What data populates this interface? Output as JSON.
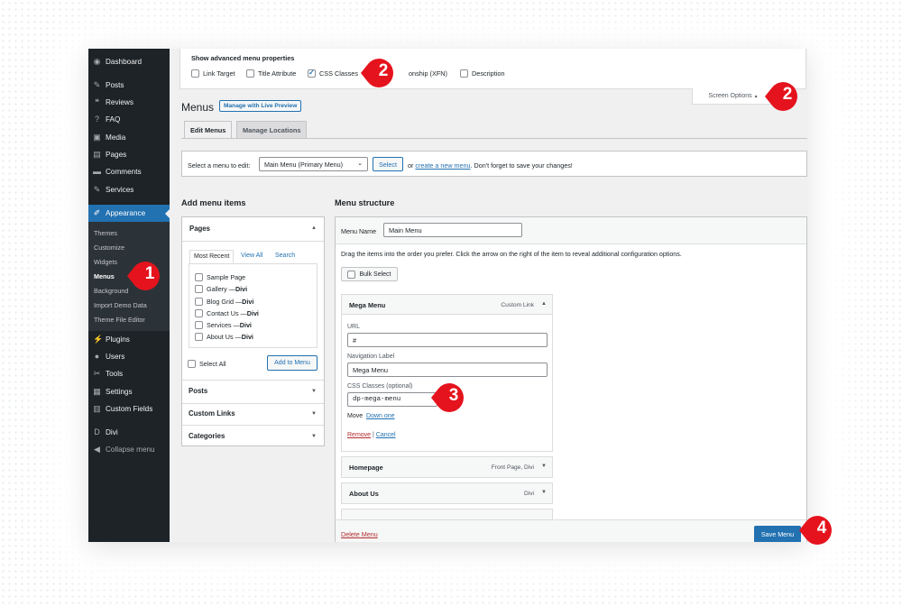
{
  "sidebar": {
    "items": [
      {
        "label": "Dashboard",
        "icon": "gauge-icon",
        "glyph": "◉"
      },
      {
        "label": "Posts",
        "icon": "pushpin-icon",
        "glyph": "✎"
      },
      {
        "label": "Reviews",
        "icon": "quote-icon",
        "glyph": "❝"
      },
      {
        "label": "FAQ",
        "icon": "question-icon",
        "glyph": "?"
      },
      {
        "label": "Media",
        "icon": "media-icon",
        "glyph": "▣"
      },
      {
        "label": "Pages",
        "icon": "pages-icon",
        "glyph": "▤"
      },
      {
        "label": "Comments",
        "icon": "comment-icon",
        "glyph": "▬"
      },
      {
        "label": "Services",
        "icon": "pushpin-icon",
        "glyph": "✎"
      },
      {
        "label": "Appearance",
        "icon": "brush-icon",
        "glyph": "✐"
      },
      {
        "label": "Plugins",
        "icon": "plugin-icon",
        "glyph": "⚡"
      },
      {
        "label": "Users",
        "icon": "user-icon",
        "glyph": "●"
      },
      {
        "label": "Tools",
        "icon": "wrench-icon",
        "glyph": "✂"
      },
      {
        "label": "Settings",
        "icon": "settings-icon",
        "glyph": "▦"
      },
      {
        "label": "Custom Fields",
        "icon": "fields-icon",
        "glyph": "▥"
      },
      {
        "label": "Divi",
        "icon": "divi-icon",
        "glyph": "D"
      },
      {
        "label": "Collapse menu",
        "icon": "collapse-icon",
        "glyph": "◀"
      }
    ],
    "submenu": [
      "Themes",
      "Customize",
      "Widgets",
      "Menus",
      "Background",
      "Import Demo Data",
      "Theme File Editor"
    ],
    "current": "Menus"
  },
  "screen_options": {
    "title": "Show advanced menu properties",
    "checkboxes": [
      {
        "label": "Link Target",
        "checked": false
      },
      {
        "label": "Title Attribute",
        "checked": false
      },
      {
        "label": "CSS Classes",
        "checked": true
      },
      {
        "label": "onship (XFN)",
        "checked": false
      },
      {
        "label": "Description",
        "checked": false
      }
    ],
    "toggle_label": "Screen Options",
    "toggle_arrow": "▲"
  },
  "header": {
    "title": "Menus",
    "live_preview": "Manage with Live Preview",
    "tabs": [
      "Edit Menus",
      "Manage Locations"
    ]
  },
  "select_bar": {
    "label": "Select a menu to edit:",
    "selected": "Main Menu (Primary Menu)",
    "button": "Select",
    "text_before": "or",
    "link": "create a new menu",
    "text_after": ". Don't forget to save your changes!"
  },
  "add_items": {
    "heading": "Add menu items",
    "pages_title": "Pages",
    "tabs": [
      "Most Recent",
      "View All",
      "Search"
    ],
    "pages": [
      {
        "name": "Sample Page",
        "suffix": ""
      },
      {
        "name": "Gallery — ",
        "suffix": "Divi"
      },
      {
        "name": "Blog Grid — ",
        "suffix": "Divi"
      },
      {
        "name": "Contact Us — ",
        "suffix": "Divi"
      },
      {
        "name": "Services — ",
        "suffix": "Divi"
      },
      {
        "name": "About Us — ",
        "suffix": "Divi"
      }
    ],
    "select_all": "Select All",
    "add_button": "Add to Menu",
    "sections": [
      "Posts",
      "Custom Links",
      "Categories"
    ]
  },
  "structure": {
    "heading": "Menu structure",
    "name_label": "Menu Name",
    "name_value": "Main Menu",
    "description": "Drag the items into the order you prefer. Click the arrow on the right of the item to reveal additional configuration options.",
    "bulk_select": "Bulk Select",
    "open_item": {
      "title": "Mega Menu",
      "type": "Custom Link",
      "url_label": "URL",
      "url_value": "#",
      "nav_label": "Navigation Label",
      "nav_value": "Mega Menu",
      "css_label": "CSS Classes (optional)",
      "css_value": "dp-mega-menu",
      "move_label": "Move",
      "move_link": "Down one",
      "remove": "Remove",
      "separator": "|",
      "cancel": "Cancel"
    },
    "items": [
      {
        "title": "Homepage",
        "type": "Front Page, Divi"
      },
      {
        "title": "About Us",
        "type": "Divi"
      }
    ],
    "delete_link": "Delete Menu",
    "save_button": "Save Menu"
  },
  "callouts": [
    "2",
    "2",
    "1",
    "3",
    "4"
  ],
  "colors": {
    "accent": "#2271b1",
    "sidebar": "#1d2327",
    "callout": "#e5131d"
  }
}
